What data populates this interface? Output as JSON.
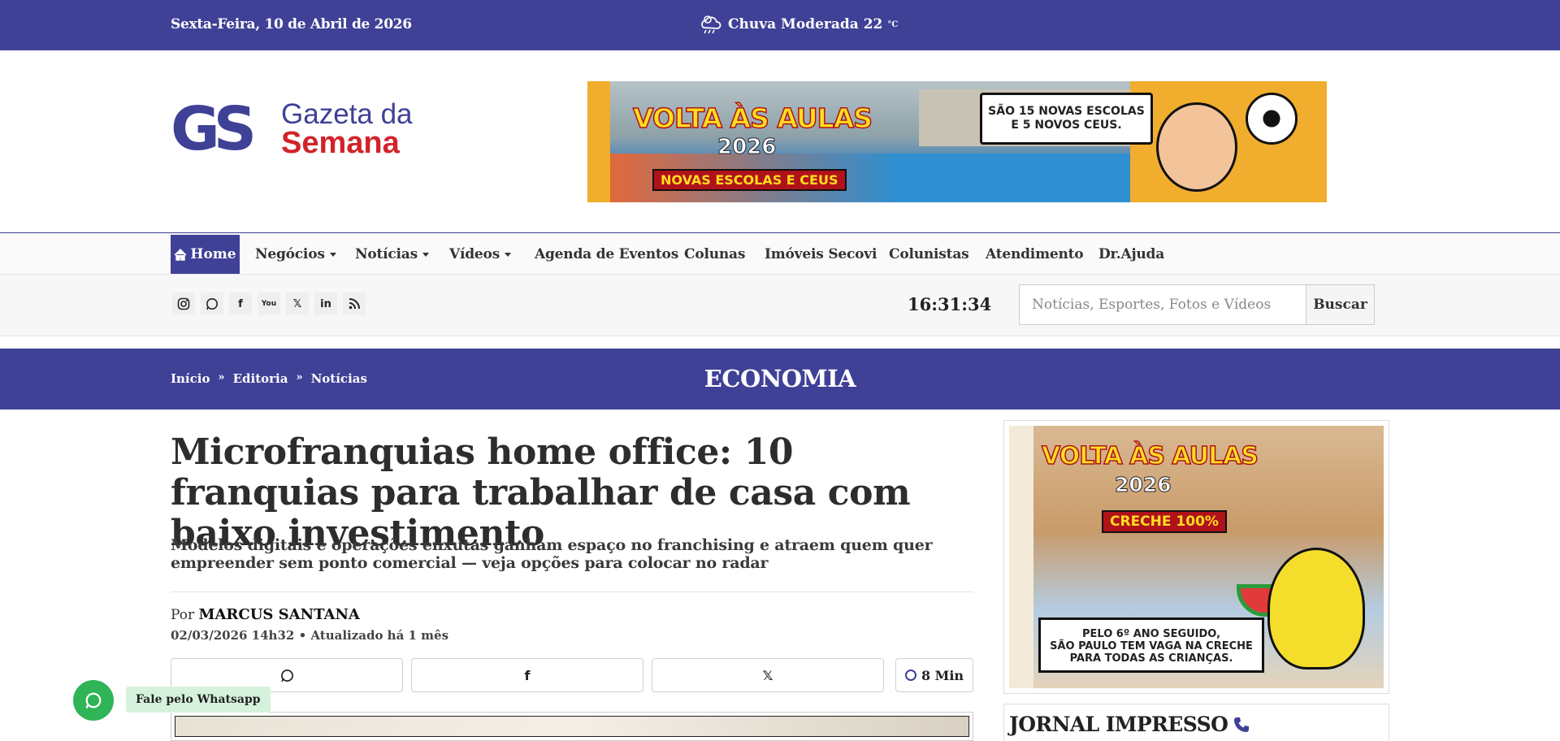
{
  "topbar": {
    "date": "Sexta-Feira, 10 de Abril de 2026",
    "weather_text": "Chuva Moderada 22",
    "weather_unit": "°C",
    "weather_icon": "rain-cloud-icon"
  },
  "logo": {
    "mark": "GS",
    "line1": "Gazeta da",
    "line2": "Semana"
  },
  "top_banner": {
    "title": "VOLTA ÀS AULAS",
    "year": "2026",
    "subtitle": "NOVAS ESCOLAS E CEUS",
    "bubble_line1": "SÃO 15 NOVAS ESCOLAS",
    "bubble_line2": "E 5 NOVOS CEUS."
  },
  "nav": {
    "home": "Home",
    "items": [
      "Negócios",
      "Notícias",
      "Vídeos",
      "Agenda de Eventos",
      "Colunas",
      "Imóveis Secovi",
      "Colunistas",
      "Atendimento",
      "Dr.Ajuda"
    ]
  },
  "socials": [
    "instagram-icon",
    "whatsapp-icon",
    "facebook-icon",
    "youtube-icon",
    "x-icon",
    "linkedin-icon",
    "rss-icon"
  ],
  "clock": "16:31:34",
  "search": {
    "placeholder": "Notícias, Esportes, Fotos e Vídeos",
    "button": "Buscar"
  },
  "section": {
    "breadcrumbs": [
      "Início",
      "Editoria",
      "Notícias"
    ],
    "title": "ECONOMIA"
  },
  "article": {
    "headline": "Microfranquias home office: 10 franquias para trabalhar de casa com baixo investimento",
    "dek": "Modelos digitais e operações enxutas ganham espaço no franchising e atraem quem quer empreender sem ponto comercial — veja opções para colocar no radar",
    "by_prefix": "Por",
    "author": "MARCUS SANTANA",
    "published": "02/03/2026 14h32",
    "updated": "Atualizado há 1 mês",
    "read_time": "8 Min"
  },
  "sidebar": {
    "ad": {
      "title": "VOLTA ÀS AULAS",
      "year": "2026",
      "subtitle": "CRECHE 100%",
      "note_line1": "PELO 6º ANO SEGUIDO,",
      "note_line2": "SÃO PAULO TEM VAGA NA CRECHE",
      "note_line3": "PARA TODAS AS CRIANÇAS."
    },
    "jornal_title": "JORNAL IMPRESSO"
  },
  "whatsapp": {
    "label": "Fale pelo Whatsapp"
  },
  "colors": {
    "brand": "#3f4197",
    "accent_red": "#d2232a",
    "whatsapp": "#2fb457"
  }
}
